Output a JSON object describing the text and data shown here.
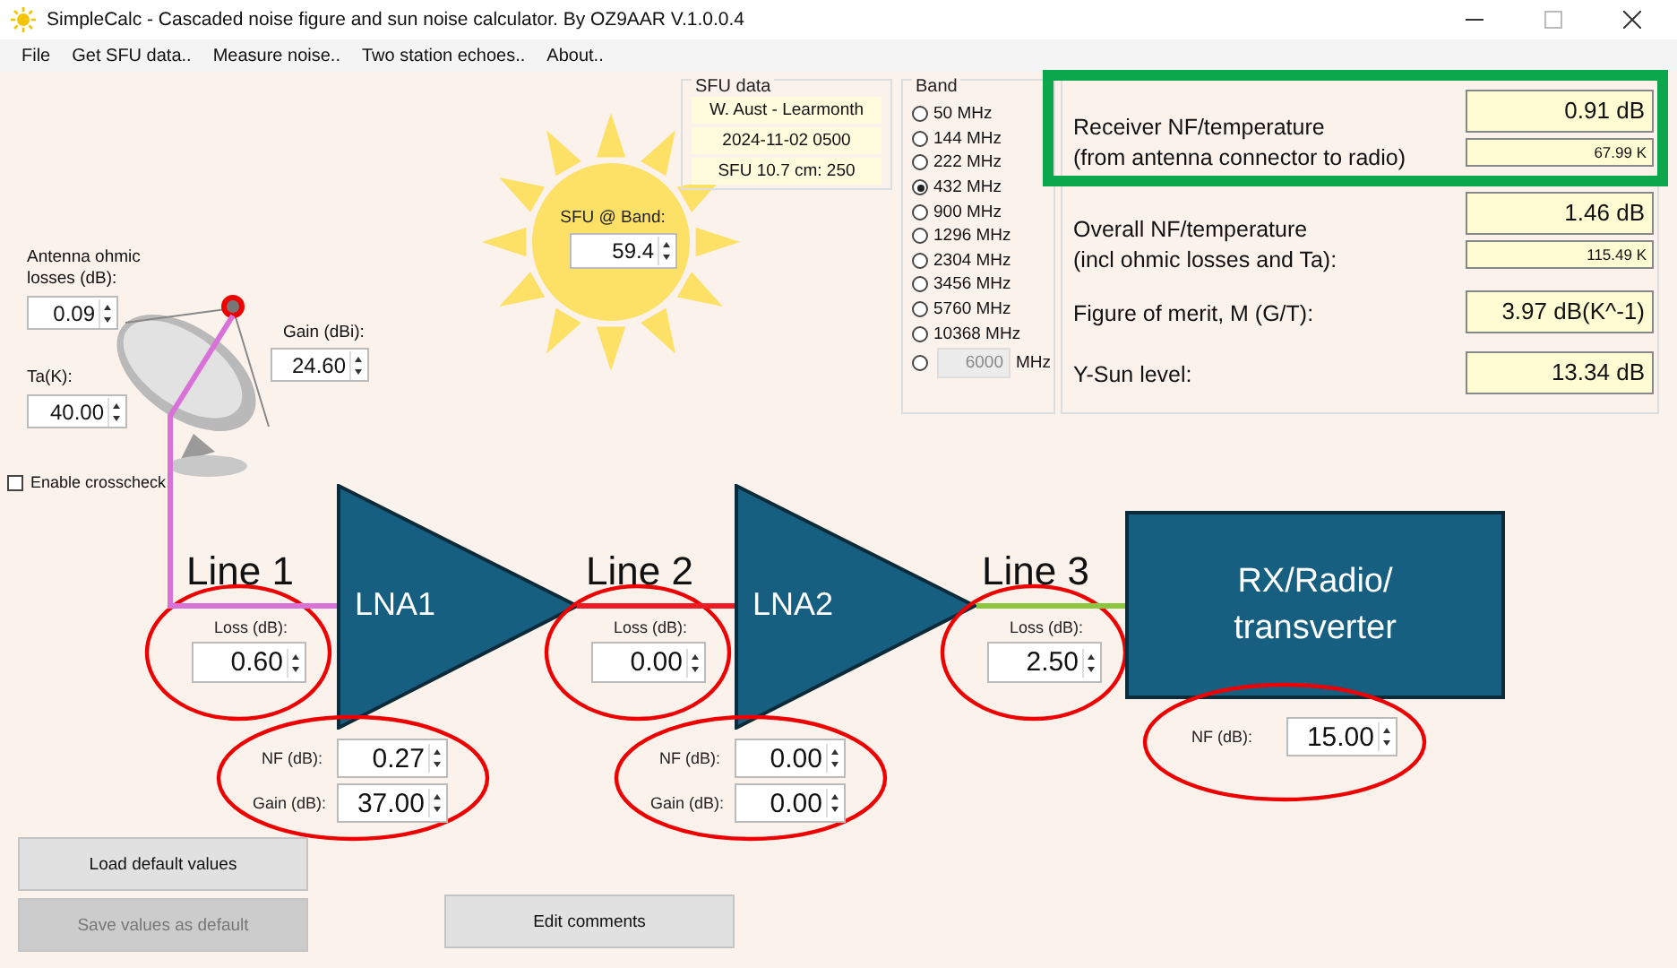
{
  "window": {
    "title": "SimpleCalc - Cascaded noise figure and sun noise calculator. By OZ9AAR V.1.0.0.4"
  },
  "menu": [
    "File",
    "Get SFU data..",
    "Measure noise..",
    "Two station echoes..",
    "About.."
  ],
  "sfu_data": {
    "title": "SFU data",
    "lines": [
      "W. Aust - Learmonth",
      "2024-11-02 0500",
      "SFU 10.7 cm: 250"
    ]
  },
  "sun": {
    "label": "SFU @ Band:",
    "value": "59.4"
  },
  "band": {
    "title": "Band",
    "options": [
      {
        "label": "50 MHz",
        "selected": false
      },
      {
        "label": "144 MHz",
        "selected": false
      },
      {
        "label": "222 MHz",
        "selected": false
      },
      {
        "label": "432 MHz",
        "selected": true
      },
      {
        "label": "900 MHz",
        "selected": false
      },
      {
        "label": "1296 MHz",
        "selected": false
      },
      {
        "label": "2304 MHz",
        "selected": false
      },
      {
        "label": "3456 MHz",
        "selected": false
      },
      {
        "label": "5760 MHz",
        "selected": false
      },
      {
        "label": "10368 MHz",
        "selected": false
      }
    ],
    "custom": {
      "value": "6000",
      "unit": "MHz",
      "selected": false,
      "disabled": true
    }
  },
  "results": [
    {
      "label": "Receiver NF/temperature",
      "label2": "(from antenna connector to radio)",
      "value": "0.91 dB",
      "sub_value": "67.99 K",
      "highlighted": true
    },
    {
      "label": "Overall NF/temperature",
      "label2": "(incl ohmic losses and Ta):",
      "value": "1.46 dB",
      "sub_value": "115.49 K",
      "highlighted": false
    },
    {
      "label": "Figure of merit, M (G/T):",
      "value": "3.97 dB(K^-1)",
      "highlighted": false
    },
    {
      "label": "Y-Sun level:",
      "value": "13.34 dB",
      "highlighted": false
    }
  ],
  "antenna": {
    "losses_label": "Antenna ohmic losses (dB):",
    "losses": "0.09",
    "ta_label": "Ta(K):",
    "ta": "40.00",
    "gain_label": "Gain (dBi):",
    "gain": "24.60"
  },
  "crosscheck": {
    "label": "Enable crosscheck",
    "checked": false
  },
  "chain": [
    {
      "kind": "line",
      "title": "Line 1",
      "loss_label": "Loss (dB):",
      "loss": "0.60",
      "color": "#d872d8",
      "circled": true
    },
    {
      "kind": "amplifier",
      "name": "LNA1",
      "nf_label": "NF (dB):",
      "nf": "0.27",
      "gain_label": "Gain (dB):",
      "gain": "37.00",
      "circled": true
    },
    {
      "kind": "line",
      "title": "Line 2",
      "loss_label": "Loss (dB):",
      "loss": "0.00",
      "color": "#ee1c24",
      "circled": true
    },
    {
      "kind": "amplifier",
      "name": "LNA2",
      "nf_label": "NF (dB):",
      "nf": "0.00",
      "gain_label": "Gain (dB):",
      "gain": "0.00",
      "circled": true
    },
    {
      "kind": "line",
      "title": "Line 3",
      "loss_label": "Loss (dB):",
      "loss": "2.50",
      "color": "#8cc63f",
      "circled": true
    },
    {
      "kind": "receiver",
      "name": "RX/Radio/ transverter",
      "nf_label": "NF (dB):",
      "nf": "15.00",
      "circled": true
    }
  ],
  "buttons": [
    {
      "label": "Load default values",
      "disabled": false
    },
    {
      "label": "Save values as default",
      "disabled": true
    },
    {
      "label": "Edit comments",
      "disabled": false
    }
  ]
}
